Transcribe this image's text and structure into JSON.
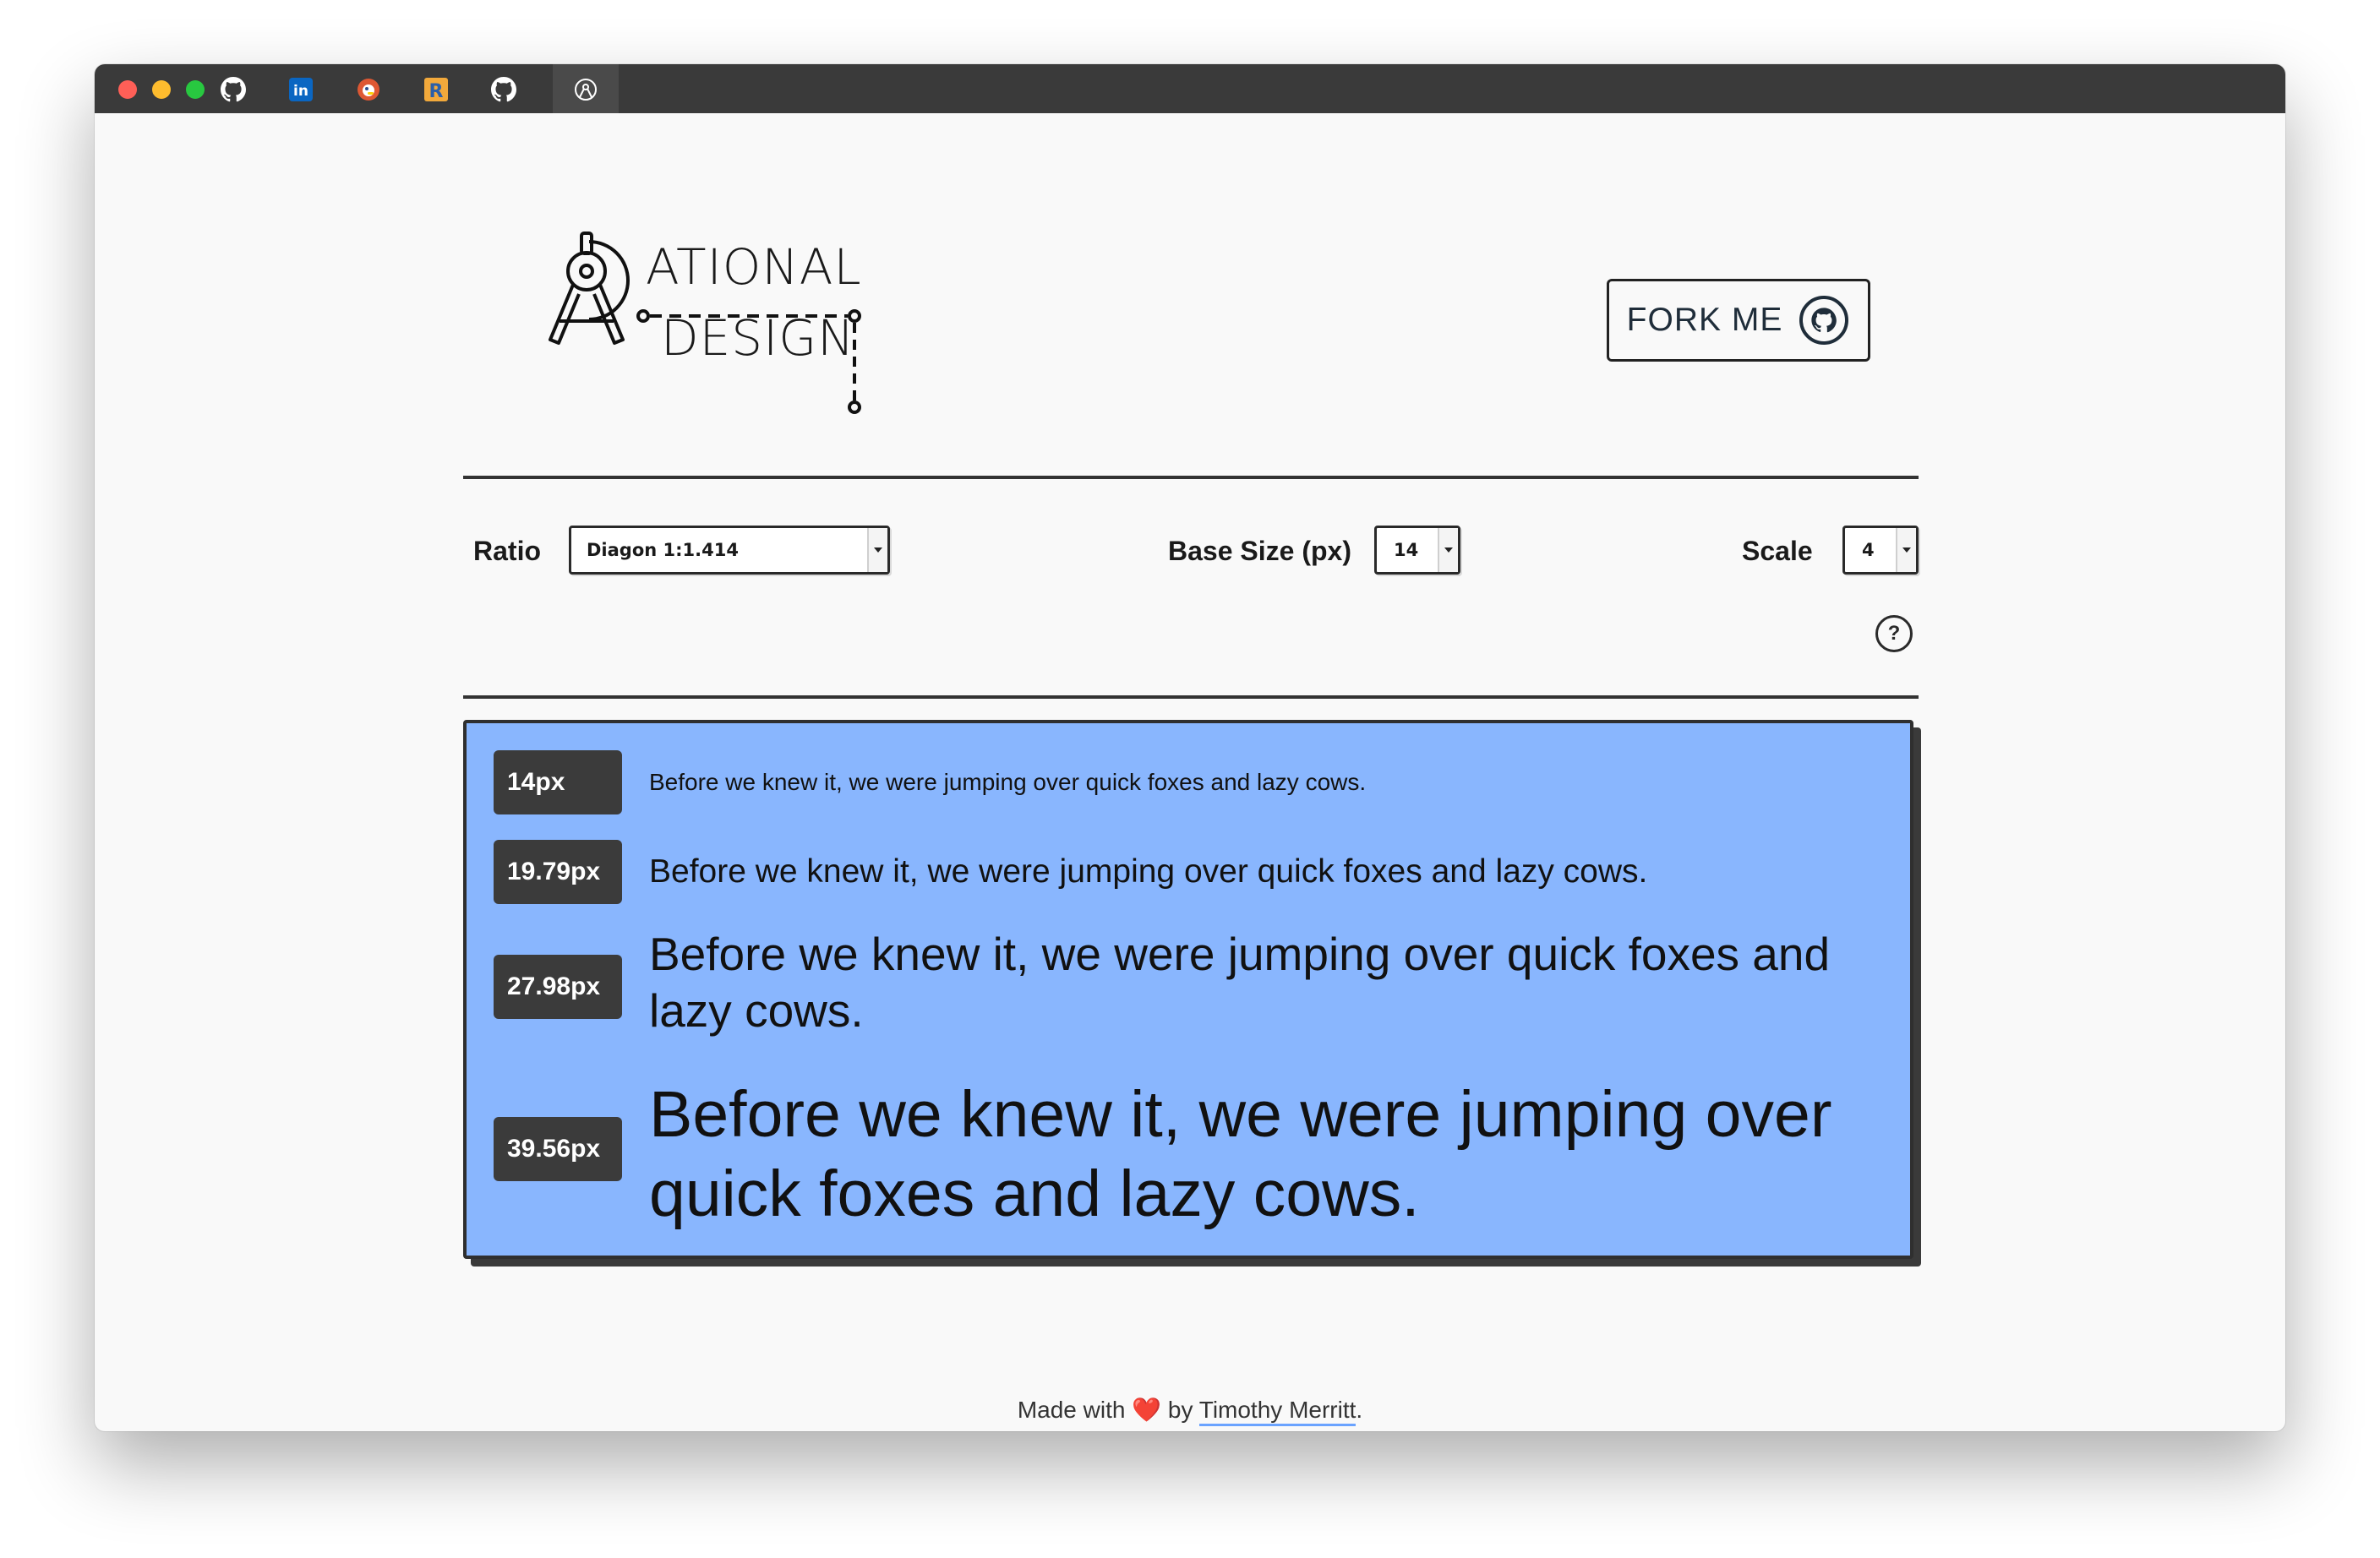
{
  "browser": {
    "tabs": [
      {
        "icon": "github-icon"
      },
      {
        "icon": "linkedin-icon"
      },
      {
        "icon": "duckduckgo-icon"
      },
      {
        "icon": "r-icon"
      },
      {
        "icon": "github-icon"
      },
      {
        "icon": "compass-icon"
      }
    ]
  },
  "header": {
    "logo_top": "ATIONAL",
    "logo_bottom": "DESIGN",
    "fork_label": "FORK ME"
  },
  "controls": {
    "ratio_label": "Ratio",
    "ratio_value": "Diagon 1:1.414",
    "base_size_label": "Base Size (px)",
    "base_size_value": "14",
    "scale_label": "Scale",
    "scale_value": "4",
    "help_symbol": "?"
  },
  "samples": [
    {
      "size_label": "14px",
      "text": "Before we knew it, we were jumping over quick foxes and lazy cows."
    },
    {
      "size_label": "19.79px",
      "text": "Before we knew it, we were jumping over quick foxes and lazy cows."
    },
    {
      "size_label": "27.98px",
      "text": "Before we knew it, we were jumping over quick foxes and lazy cows."
    },
    {
      "size_label": "39.56px",
      "text": "Before we knew it, we were jumping over quick foxes and lazy cows."
    }
  ],
  "footer": {
    "prefix": "Made with",
    "heart": "❤️",
    "by": "by",
    "author": "Timothy Merritt",
    "suffix": "."
  },
  "colors": {
    "panel": "#89b6fe",
    "badge": "#3b3b3b",
    "titlebar": "#3a3a3a",
    "link_underline": "#6aa3ff"
  }
}
